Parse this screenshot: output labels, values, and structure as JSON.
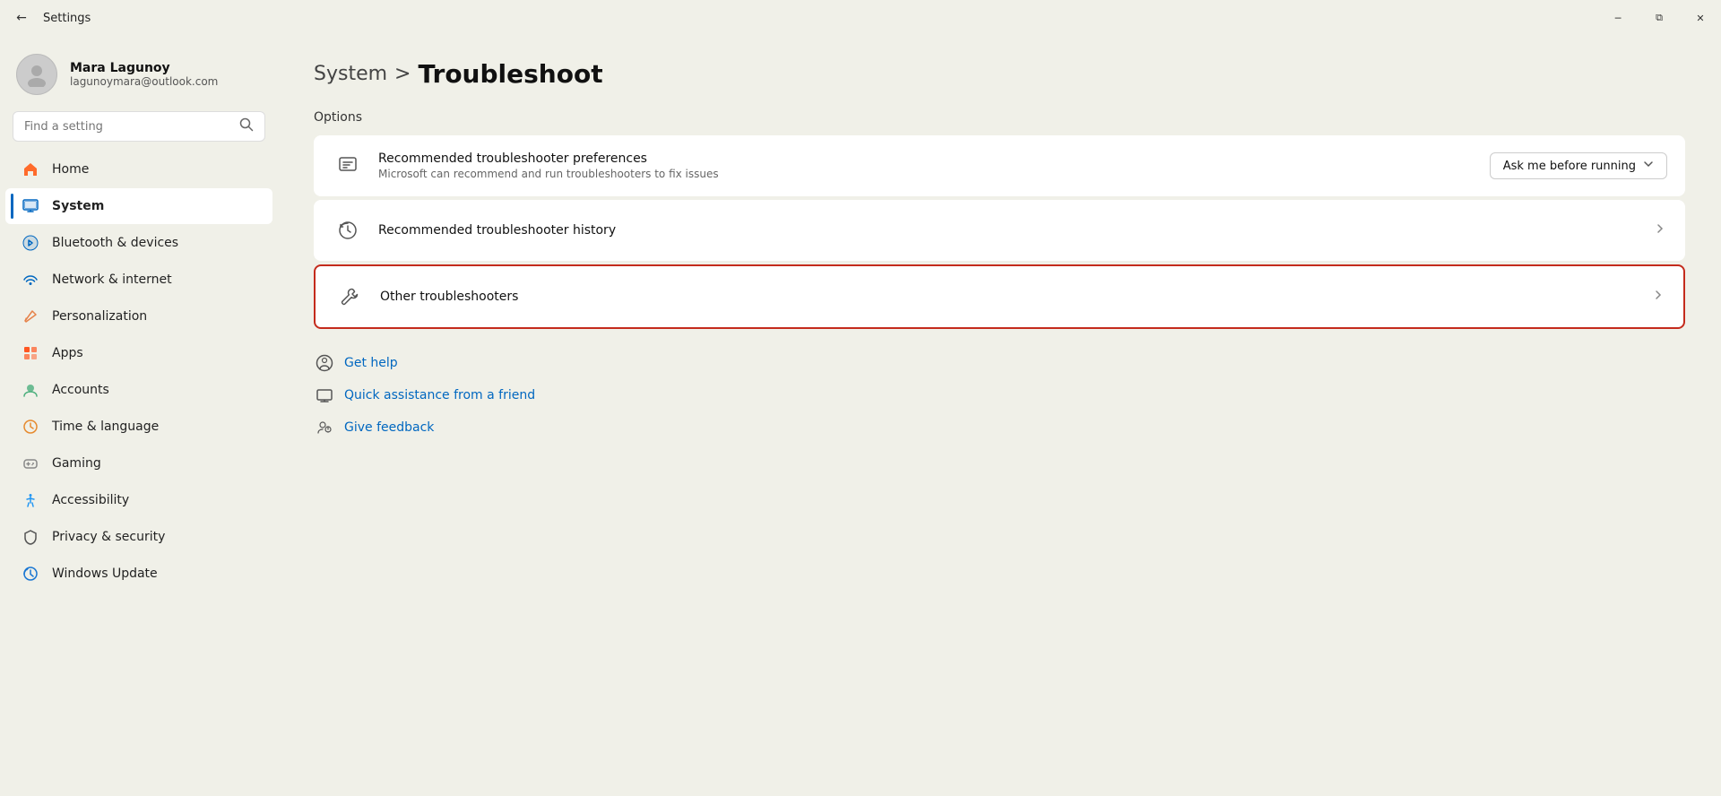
{
  "titlebar": {
    "title": "Settings",
    "back_label": "←",
    "minimize_label": "─",
    "restore_label": "⧉",
    "close_label": "✕"
  },
  "sidebar": {
    "user": {
      "name": "Mara Lagunoy",
      "email": "lagunoymara@outlook.com"
    },
    "search_placeholder": "Find a setting",
    "nav_items": [
      {
        "id": "home",
        "label": "Home",
        "icon": "🏠",
        "active": false
      },
      {
        "id": "system",
        "label": "System",
        "icon": "🖥",
        "active": true
      },
      {
        "id": "bluetooth",
        "label": "Bluetooth & devices",
        "icon": "🔵",
        "active": false
      },
      {
        "id": "network",
        "label": "Network & internet",
        "icon": "💠",
        "active": false
      },
      {
        "id": "personalization",
        "label": "Personalization",
        "icon": "✏️",
        "active": false
      },
      {
        "id": "apps",
        "label": "Apps",
        "icon": "📦",
        "active": false
      },
      {
        "id": "accounts",
        "label": "Accounts",
        "icon": "👤",
        "active": false
      },
      {
        "id": "time",
        "label": "Time & language",
        "icon": "🌐",
        "active": false
      },
      {
        "id": "gaming",
        "label": "Gaming",
        "icon": "🎮",
        "active": false
      },
      {
        "id": "accessibility",
        "label": "Accessibility",
        "icon": "♿",
        "active": false
      },
      {
        "id": "privacy",
        "label": "Privacy & security",
        "icon": "🛡",
        "active": false
      },
      {
        "id": "update",
        "label": "Windows Update",
        "icon": "🔄",
        "active": false
      }
    ]
  },
  "content": {
    "breadcrumb_parent": "System",
    "breadcrumb_separator": ">",
    "breadcrumb_current": "Troubleshoot",
    "section_label": "Options",
    "cards": [
      {
        "id": "recommended-prefs",
        "title": "Recommended troubleshooter preferences",
        "subtitle": "Microsoft can recommend and run troubleshooters to fix issues",
        "has_dropdown": true,
        "dropdown_value": "Ask me before running",
        "highlighted": false
      },
      {
        "id": "recommended-history",
        "title": "Recommended troubleshooter history",
        "subtitle": "",
        "has_dropdown": false,
        "has_chevron": true,
        "highlighted": false
      },
      {
        "id": "other-troubleshooters",
        "title": "Other troubleshooters",
        "subtitle": "",
        "has_dropdown": false,
        "has_chevron": true,
        "highlighted": true
      }
    ],
    "links": [
      {
        "id": "get-help",
        "label": "Get help"
      },
      {
        "id": "quick-assist",
        "label": "Quick assistance from a friend"
      },
      {
        "id": "give-feedback",
        "label": "Give feedback"
      }
    ]
  }
}
